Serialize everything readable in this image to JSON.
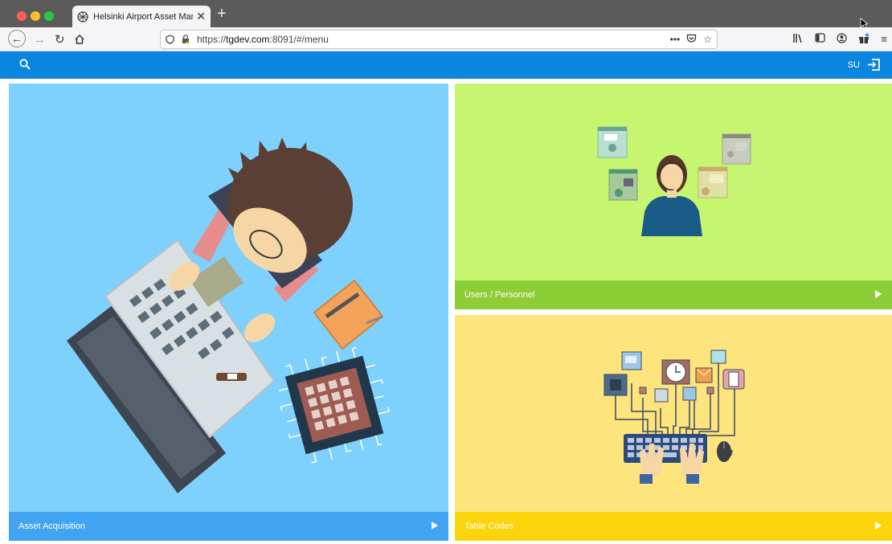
{
  "browser": {
    "tab_title": "Helsinki Airport Asset Managem",
    "url_prefix": "https://",
    "url_host": "tgdev.com",
    "url_rest": ":8091/#/menu"
  },
  "appbar": {
    "user_initials": "SU"
  },
  "tiles": {
    "asset": {
      "label": "Asset Acquisition"
    },
    "users": {
      "label": "Users / Personnel"
    },
    "codes": {
      "label": "Table Codes"
    }
  },
  "colors": {
    "appbar": "#0a85e0",
    "asset_bg": "#7dd1fc",
    "asset_bar": "#40a4f2",
    "users_bg": "#c6f66f",
    "users_bar": "#8dcd35",
    "codes_bg": "#fde47c",
    "codes_bar": "#fcd40b"
  },
  "icons": [
    "search-icon",
    "logout-icon",
    "play-arrow-icon",
    "back-icon",
    "forward-icon",
    "reload-icon",
    "home-icon",
    "shield-icon",
    "lock-icon",
    "more-icon",
    "pocket-icon",
    "bookmark-star-icon",
    "library-icon",
    "sidebar-icon",
    "account-icon",
    "gift-icon",
    "menu-icon"
  ]
}
